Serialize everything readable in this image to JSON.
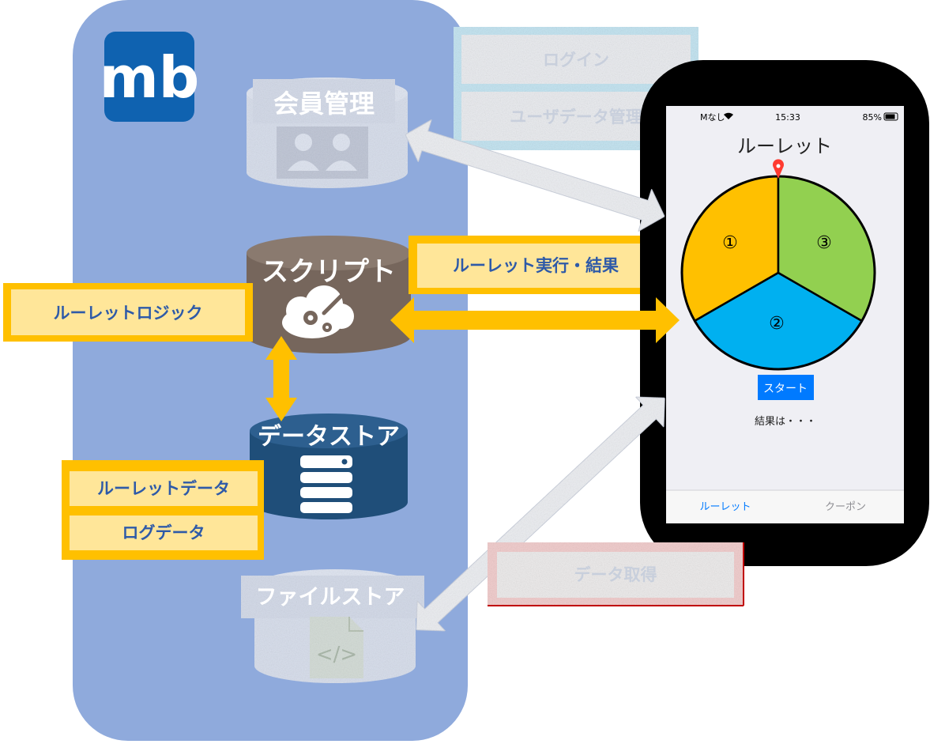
{
  "colors": {
    "backend_panel": "#8faadc",
    "logo_bg": "#0f62b0",
    "script_db": "#76665c",
    "datastore_db": "#1f4e79",
    "highlight_fill": "#ffe699",
    "highlight_border": "#ffc000",
    "label_text": "#2e5aa8",
    "faded_fill": "#e8eaef",
    "phone_frame": "#000000",
    "screen_bg": "#efeff4",
    "roulette_1": "#ffc000",
    "roulette_2": "#00b0f0",
    "roulette_3": "#92d050",
    "start_button": "#007aff",
    "faded_pink_border": "#c00000"
  },
  "backend": {
    "logo_text": "mb",
    "member_db": {
      "label": "会員管理",
      "icon": "users-icon"
    },
    "script_db": {
      "label": "スクリプト",
      "icon": "cloud-gears-icon"
    },
    "datastore_db": {
      "label": "データストア",
      "icon": "server-stack-icon"
    },
    "filestore_db": {
      "label": "ファイルストア",
      "icon": "code-file-icon"
    }
  },
  "labels": {
    "login": "ログイン",
    "user_data": "ユーザデータ管理",
    "roulette_exec": "ルーレット実行・結果",
    "roulette_logic": "ルーレットロジック",
    "roulette_data": "ルーレットデータ",
    "log_data": "ログデータ",
    "data_fetch": "データ取得"
  },
  "phone": {
    "status": {
      "carrier": "Mなし",
      "time": "15:33",
      "battery": "85%"
    },
    "title": "ルーレット",
    "segments": [
      "①",
      "②",
      "③"
    ],
    "start_button": "スタート",
    "result_text": "結果は・・・",
    "tabs": [
      "ルーレット",
      "クーポン"
    ]
  }
}
